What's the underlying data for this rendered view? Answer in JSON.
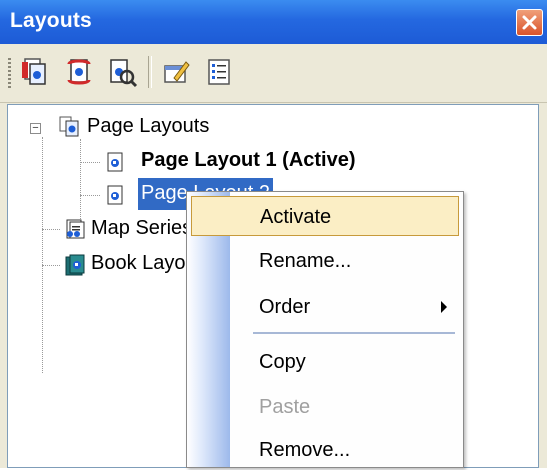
{
  "panel": {
    "title": "Layouts"
  },
  "toolbar": {
    "buttons": [
      {
        "icon": "new-page-layout-icon"
      },
      {
        "icon": "new-map-series-icon"
      },
      {
        "icon": "new-book-icon"
      },
      {
        "icon": "properties-icon"
      },
      {
        "icon": "list-view-icon"
      }
    ]
  },
  "tree": {
    "root": {
      "label": "Page Layouts",
      "expanded": true
    },
    "children": [
      {
        "label": "Page Layout 1 (Active)",
        "bold": true
      },
      {
        "label": "Page Layout 2",
        "selected": true
      }
    ],
    "siblings": [
      {
        "label": "Map Series"
      },
      {
        "label": "Book Layouts"
      }
    ]
  },
  "context_menu": {
    "items": [
      {
        "label": "Activate",
        "highlighted": true
      },
      {
        "label": "Rename..."
      },
      {
        "label": "Order",
        "submenu": true
      },
      {
        "label": "Copy"
      },
      {
        "label": "Paste",
        "disabled": true
      },
      {
        "label": "Remove..."
      }
    ]
  },
  "colors": {
    "titlebar": "#2468e0",
    "selection": "#316ac5",
    "menu_hover": "#fbeec5",
    "menu_hover_border": "#c79a3b"
  }
}
